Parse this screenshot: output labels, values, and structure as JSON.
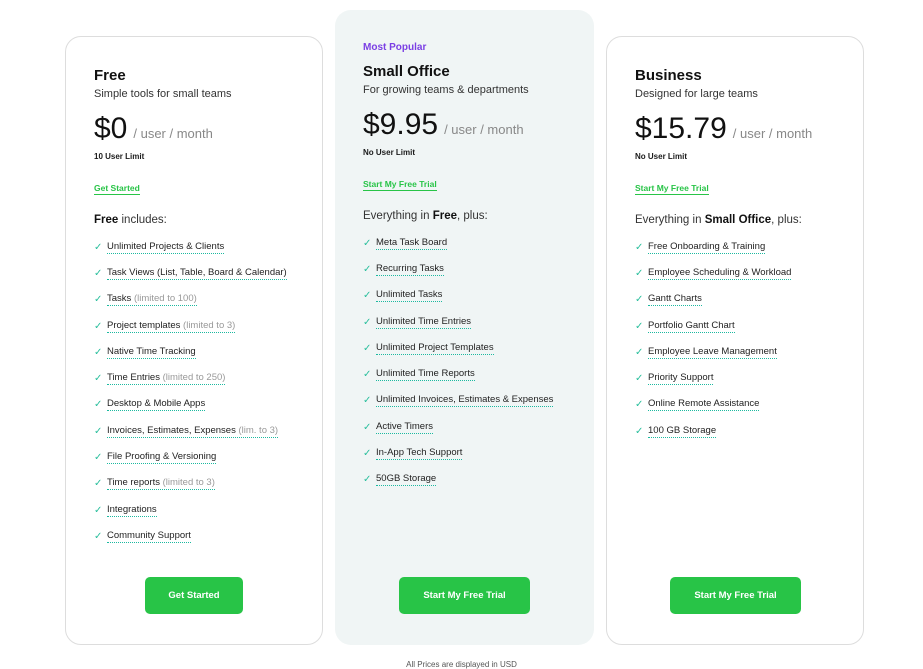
{
  "plans": [
    {
      "name": "Free",
      "subtitle": "Simple tools for small teams",
      "price": "$0",
      "per": "/ user / month",
      "limit": "10 User Limit",
      "link": "Get Started",
      "includes_prefix": "",
      "includes_bold": "Free",
      "includes_suffix": " includes:",
      "button": "Get Started",
      "features": [
        {
          "text": "Unlimited Projects & Clients",
          "note": ""
        },
        {
          "text": "Task Views (List, Table, Board & Calendar)",
          "note": ""
        },
        {
          "text": "Tasks",
          "note": "(limited to 100)"
        },
        {
          "text": "Project templates",
          "note": "(limited to 3)"
        },
        {
          "text": "Native Time Tracking",
          "note": ""
        },
        {
          "text": "Time Entries",
          "note": "(limited to 250)"
        },
        {
          "text": "Desktop & Mobile Apps",
          "note": ""
        },
        {
          "text": "Invoices, Estimates, Expenses",
          "note": "(lim. to 3)"
        },
        {
          "text": "File Proofing & Versioning",
          "note": ""
        },
        {
          "text": "Time reports",
          "note": "(limited to 3)"
        },
        {
          "text": "Integrations",
          "note": ""
        },
        {
          "text": "Community Support",
          "note": ""
        }
      ]
    },
    {
      "badge": "Most Popular",
      "name": "Small Office",
      "subtitle": "For growing teams & departments",
      "price": "$9.95",
      "per": "/ user / month",
      "limit": "No User Limit",
      "link": "Start My Free Trial",
      "includes_prefix": "Everything in ",
      "includes_bold": "Free",
      "includes_suffix": ", plus:",
      "button": "Start My Free Trial",
      "features": [
        {
          "text": "Meta Task Board",
          "note": ""
        },
        {
          "text": "Recurring Tasks",
          "note": ""
        },
        {
          "text": "Unlimited Tasks",
          "note": ""
        },
        {
          "text": "Unlimited Time Entries",
          "note": ""
        },
        {
          "text": "Unlimited Project Templates",
          "note": ""
        },
        {
          "text": "Unlimited Time Reports",
          "note": ""
        },
        {
          "text": "Unlimited Invoices, Estimates & Expenses",
          "note": ""
        },
        {
          "text": "Active Timers",
          "note": ""
        },
        {
          "text": "In-App Tech Support",
          "note": ""
        },
        {
          "text": "50GB Storage",
          "note": ""
        }
      ]
    },
    {
      "name": "Business",
      "subtitle": "Designed for large teams",
      "price": "$15.79",
      "per": "/ user / month",
      "limit": "No User Limit",
      "link": "Start My Free Trial",
      "includes_prefix": "Everything in ",
      "includes_bold": "Small Office",
      "includes_suffix": ", plus:",
      "button": "Start My Free Trial",
      "features": [
        {
          "text": "Free Onboarding & Training",
          "note": ""
        },
        {
          "text": "Employee Scheduling & Workload",
          "note": ""
        },
        {
          "text": "Gantt Charts",
          "note": ""
        },
        {
          "text": "Portfolio Gantt Chart",
          "note": ""
        },
        {
          "text": "Employee Leave Management",
          "note": ""
        },
        {
          "text": "Priority Support",
          "note": ""
        },
        {
          "text": "Online Remote Assistance",
          "note": ""
        },
        {
          "text": "100 GB Storage",
          "note": ""
        }
      ]
    }
  ],
  "footer": "All Prices are displayed in USD",
  "colors": {
    "accent": "#28c447",
    "popular": "#7b3fe4",
    "check": "#2bbf9d",
    "highlight_bg": "#f0f5f5"
  }
}
